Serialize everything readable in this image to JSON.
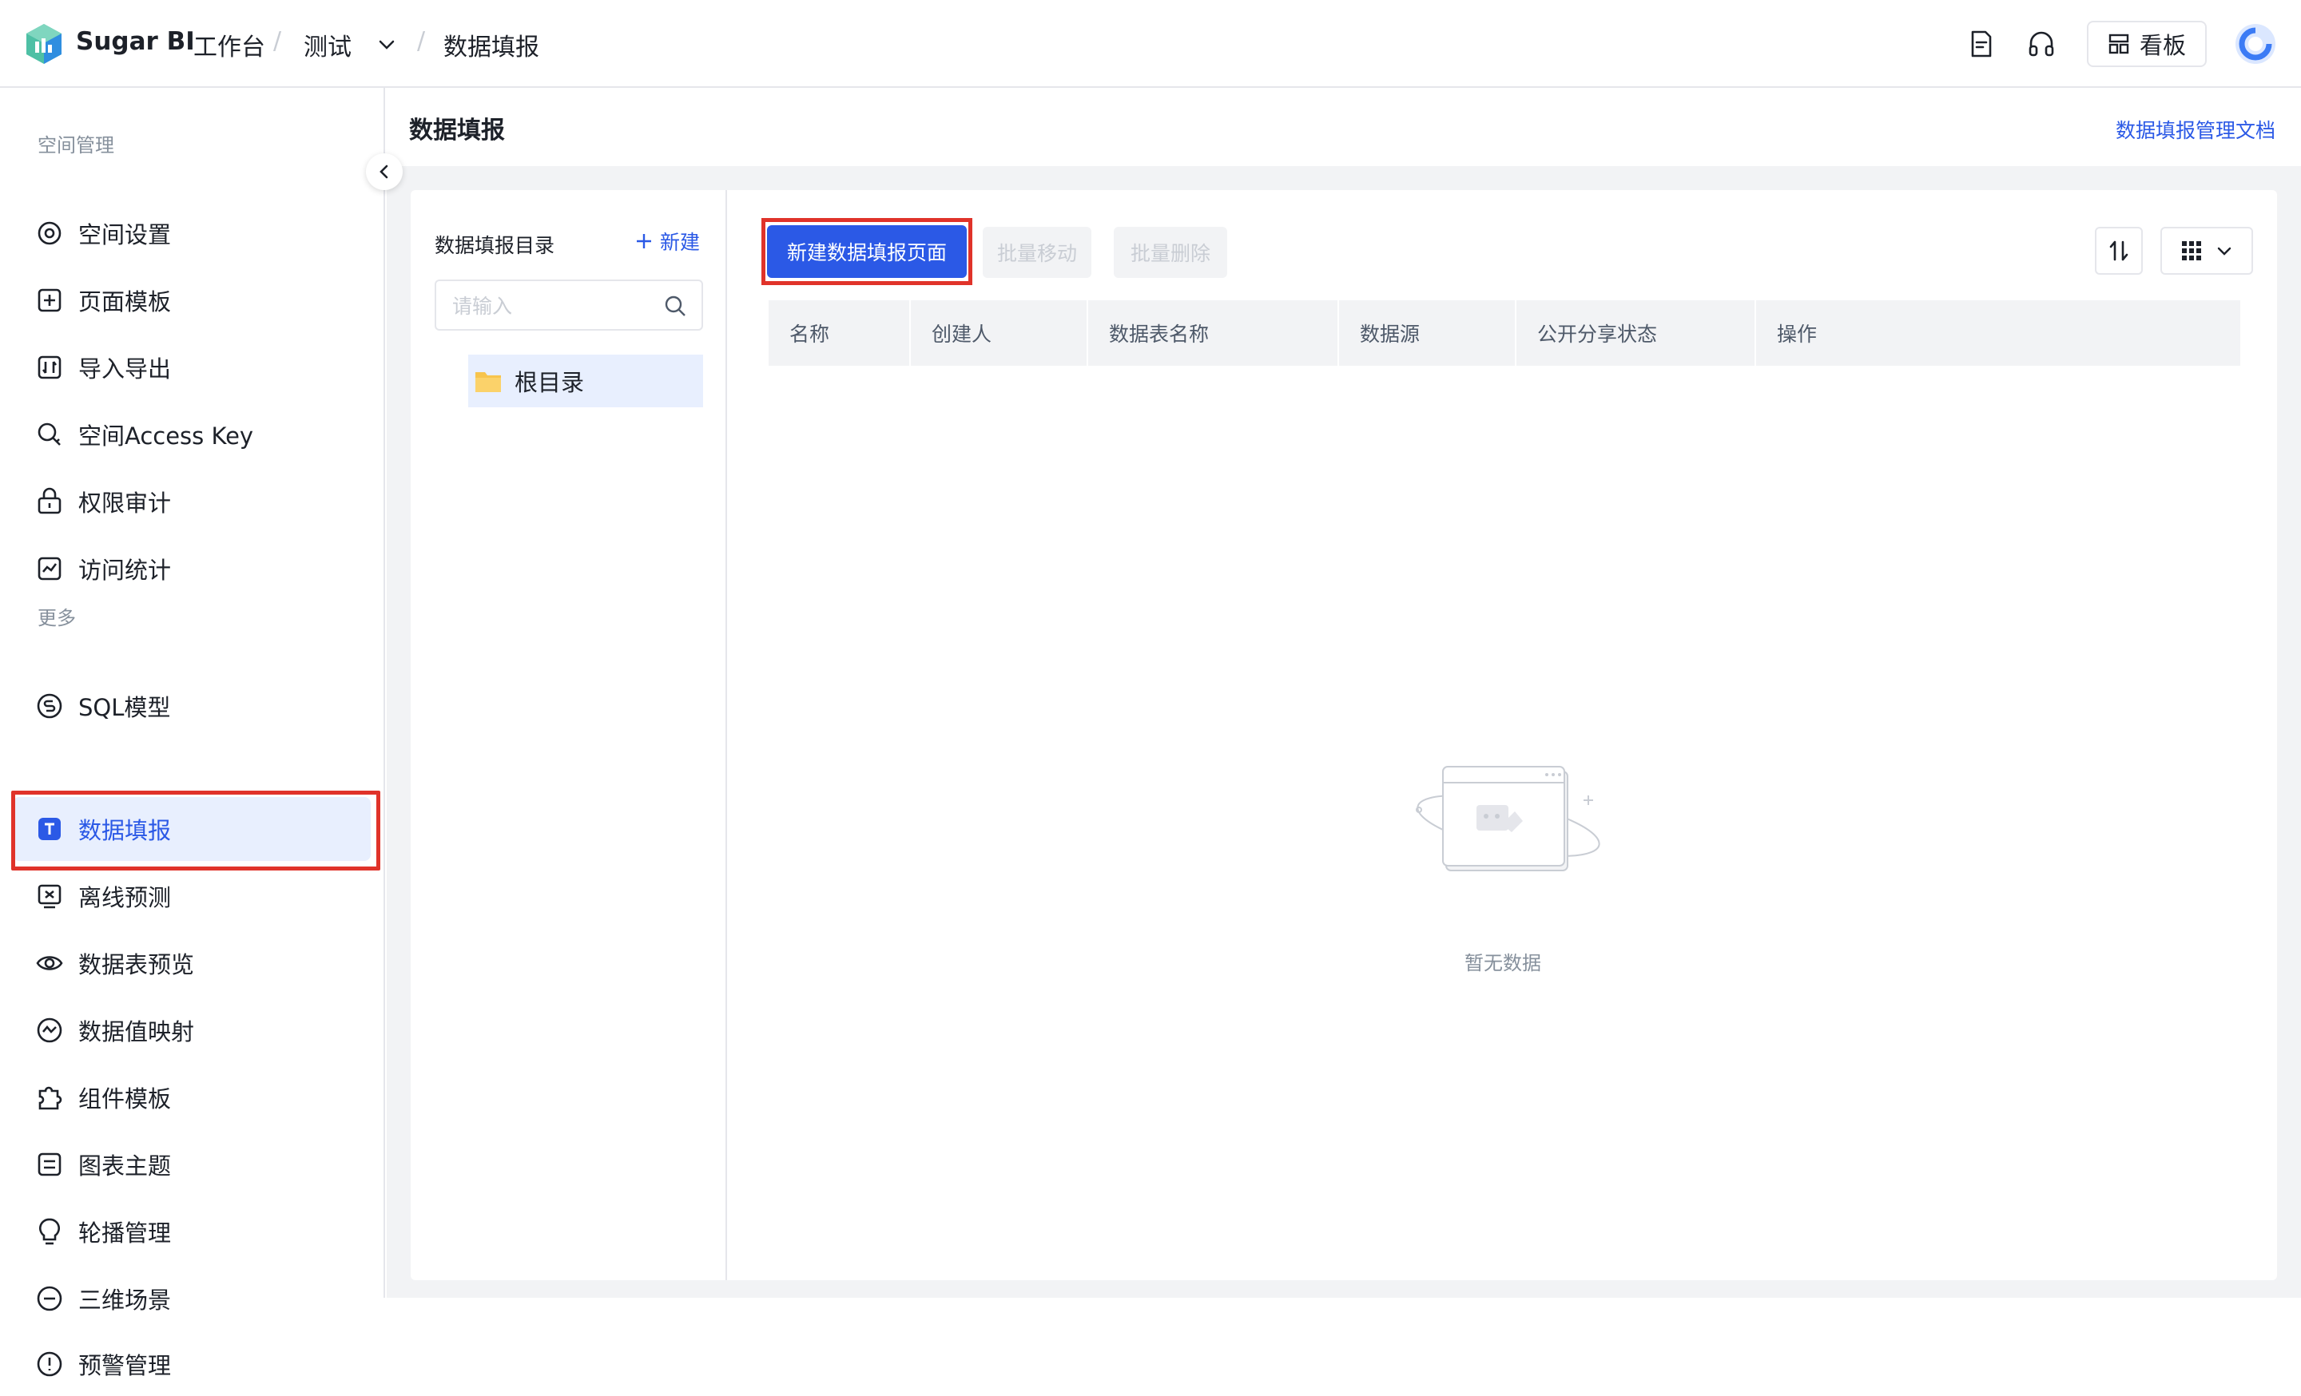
{
  "header": {
    "brand": "Sugar BI",
    "workbench": "工作台",
    "separator": "/",
    "space": "测试",
    "current": "数据填报",
    "dashboard_button": "看板"
  },
  "sidebar": {
    "section_space": "空间管理",
    "space_items": [
      {
        "label": "空间设置",
        "icon": "gear-icon"
      },
      {
        "label": "页面模板",
        "icon": "page-template-icon"
      },
      {
        "label": "导入导出",
        "icon": "import-export-icon"
      },
      {
        "label": "空间Access Key",
        "icon": "key-icon"
      },
      {
        "label": "权限审计",
        "icon": "lock-icon"
      },
      {
        "label": "访问统计",
        "icon": "stats-icon"
      }
    ],
    "section_more": "更多",
    "more_items": [
      {
        "label": "SQL模型",
        "icon": "sql-icon"
      },
      {
        "label": "数据填报",
        "icon": "data-fill-icon",
        "active": true
      },
      {
        "label": "离线预测",
        "icon": "forecast-icon"
      },
      {
        "label": "数据表预览",
        "icon": "eye-icon"
      },
      {
        "label": "数据值映射",
        "icon": "mapping-icon"
      },
      {
        "label": "组件模板",
        "icon": "puzzle-icon"
      },
      {
        "label": "图表主题",
        "icon": "theme-icon"
      },
      {
        "label": "轮播管理",
        "icon": "bulb-icon"
      },
      {
        "label": "三维场景",
        "icon": "scene-3d-icon"
      },
      {
        "label": "预警管理",
        "icon": "alert-icon"
      }
    ]
  },
  "main": {
    "title": "数据填报",
    "doc_link": "数据填报管理文档",
    "directory": {
      "title": "数据填报目录",
      "new_label": "新建",
      "search_placeholder": "请输入",
      "root_folder": "根目录"
    },
    "toolbar": {
      "create_label": "新建数据填报页面",
      "batch_move": "批量移动",
      "batch_delete": "批量删除"
    },
    "table": {
      "columns": [
        "名称",
        "创建人",
        "数据表名称",
        "数据源",
        "公开分享状态",
        "操作"
      ]
    },
    "empty_text": "暂无数据"
  },
  "colors": {
    "primary": "#2b59e6",
    "highlight": "#e0332a",
    "active_bg": "#e8effe"
  }
}
